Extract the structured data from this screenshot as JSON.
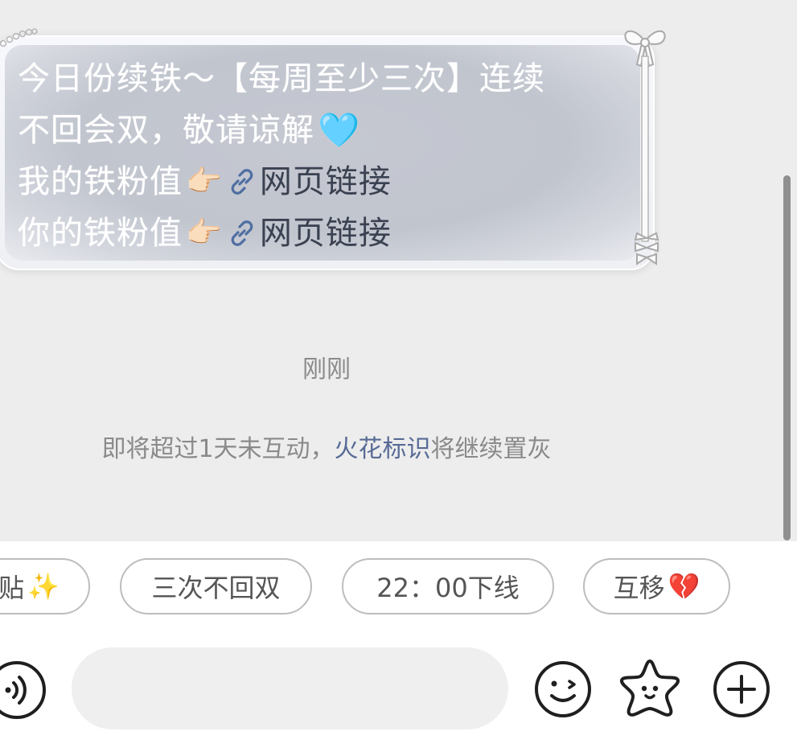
{
  "message": {
    "line1": "今日份续铁～【每周至少三次】连续",
    "line2": "不回会双，敬请谅解",
    "line3_prefix": "我的铁粉值",
    "line4_prefix": "你的铁粉值",
    "link_text": "网页链接",
    "heart_emoji": "🩵",
    "point_emoji": "👉🏻"
  },
  "timestamp": "刚刚",
  "notice": {
    "before": "即将超过1天未互动，",
    "link": "火花标识",
    "after": "将继续置灰"
  },
  "quick_replies": [
    {
      "label": "贴",
      "emoji": "✨"
    },
    {
      "label": "三次不回双",
      "emoji": ""
    },
    {
      "label": "22：00下线",
      "emoji": ""
    },
    {
      "label": "互移",
      "emoji": "💔"
    }
  ],
  "input": {
    "value": "",
    "placeholder": ""
  },
  "colors": {
    "link": "#576b95",
    "bubble_fill": "#c3c6cf",
    "chat_bg": "#ededed"
  },
  "icons": [
    "voice-icon",
    "emoji-face-icon",
    "sticker-star-icon",
    "plus-icon",
    "link-icon",
    "bow-icon"
  ]
}
